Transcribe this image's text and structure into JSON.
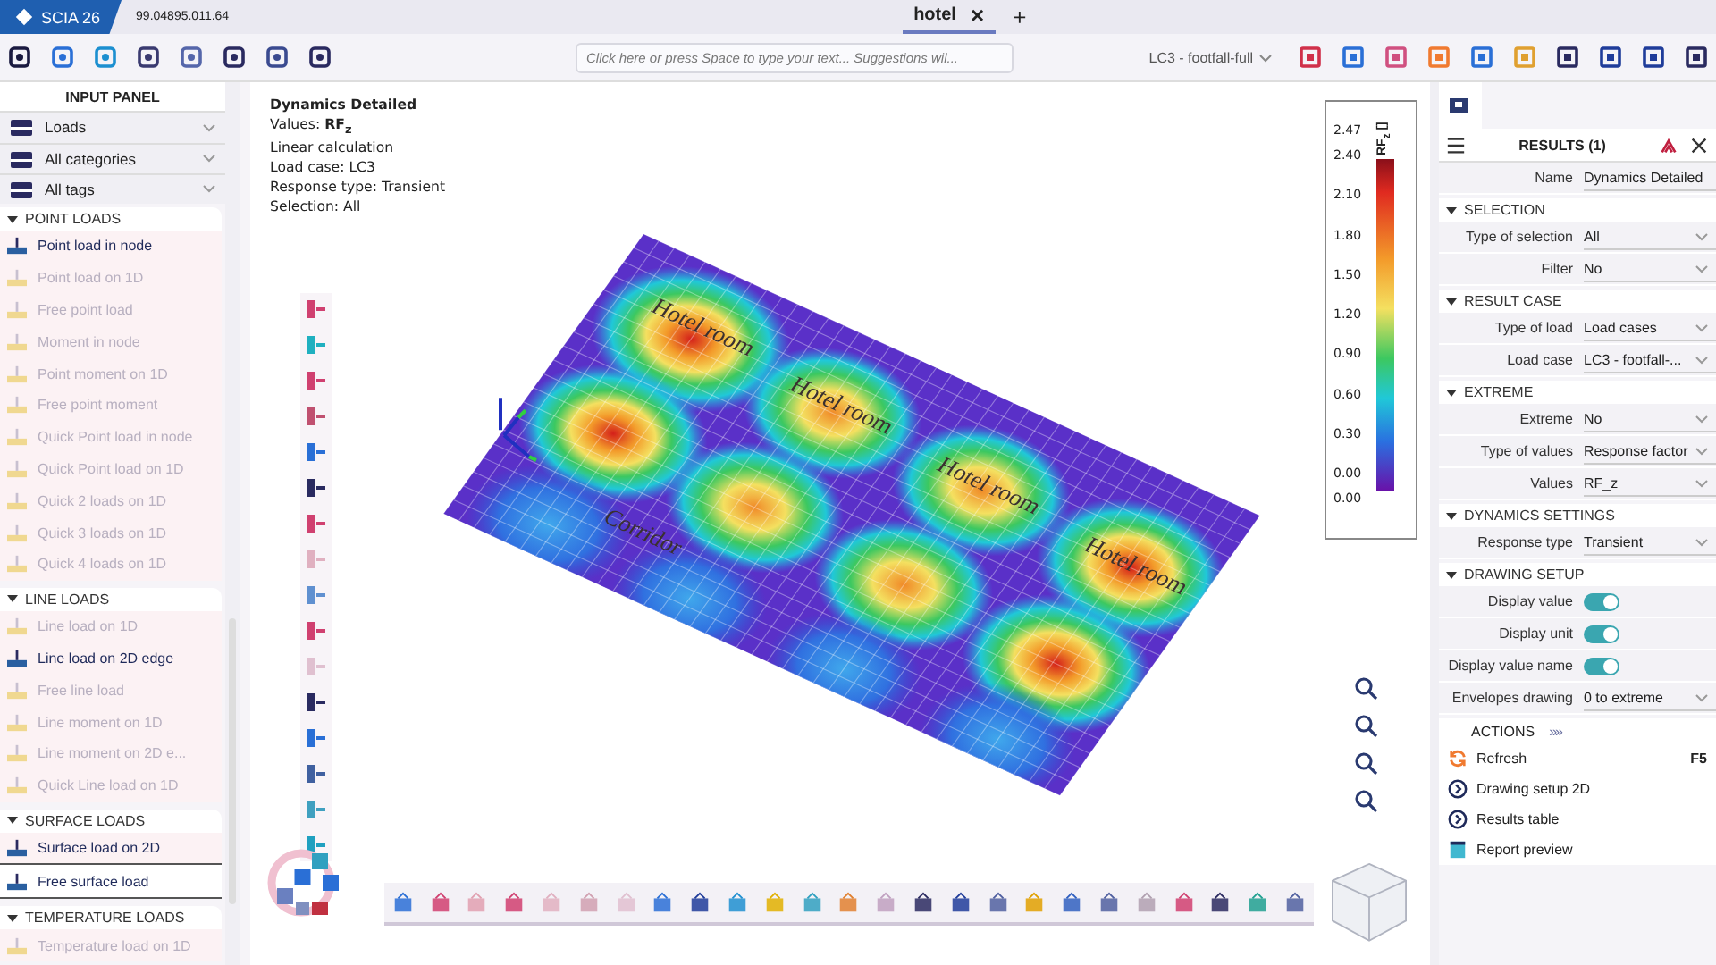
{
  "app": {
    "name": "SCIA 26",
    "version": "99.04895.011.64"
  },
  "tabs": [
    {
      "label": "hotel",
      "selected": true,
      "close": "×"
    }
  ],
  "new_tab": "+",
  "toolbar": {
    "command_placeholder": "Click here or press Space to type your text... Suggestions wil...",
    "load_case": "LC3 - footfall-full"
  },
  "input_panel": {
    "title": "INPUT PANEL",
    "filters": [
      {
        "label": "Loads"
      },
      {
        "label": "All categories"
      },
      {
        "label": "All tags"
      }
    ],
    "groups": [
      {
        "title": "POINT LOADS",
        "expanded": true,
        "items": [
          {
            "label": "Point load in node",
            "enabled": true,
            "selected": false
          },
          {
            "label": "Point load on 1D",
            "enabled": false,
            "selected": false
          },
          {
            "label": "Free point load",
            "enabled": false,
            "selected": false
          },
          {
            "label": "Moment in node",
            "enabled": false,
            "selected": false
          },
          {
            "label": "Point moment on 1D",
            "enabled": false,
            "selected": false
          },
          {
            "label": "Free point moment",
            "enabled": false,
            "selected": false
          },
          {
            "label": "Quick Point load in node",
            "enabled": false,
            "selected": false
          },
          {
            "label": "Quick Point load on 1D",
            "enabled": false,
            "selected": false
          },
          {
            "label": "Quick 2 loads on 1D",
            "enabled": false,
            "selected": false
          },
          {
            "label": "Quick 3 loads on 1D",
            "enabled": false,
            "selected": false
          },
          {
            "label": "Quick 4 loads on 1D",
            "enabled": false,
            "selected": false
          }
        ]
      },
      {
        "title": "LINE LOADS",
        "expanded": true,
        "items": [
          {
            "label": "Line load on 1D",
            "enabled": false,
            "selected": false
          },
          {
            "label": "Line load on 2D edge",
            "enabled": true,
            "selected": false
          },
          {
            "label": "Free line load",
            "enabled": false,
            "selected": false
          },
          {
            "label": "Line moment on 1D",
            "enabled": false,
            "selected": false
          },
          {
            "label": "Line moment on 2D e...",
            "enabled": false,
            "selected": false
          },
          {
            "label": "Quick Line load on 1D",
            "enabled": false,
            "selected": false
          }
        ]
      },
      {
        "title": "SURFACE LOADS",
        "expanded": true,
        "items": [
          {
            "label": "Surface load on 2D",
            "enabled": true,
            "selected": false
          },
          {
            "label": "Free surface load",
            "enabled": true,
            "selected": true
          }
        ]
      },
      {
        "title": "TEMPERATURE LOADS",
        "expanded": true,
        "items": [
          {
            "label": "Temperature load on 1D",
            "enabled": false,
            "selected": false
          }
        ]
      }
    ]
  },
  "view": {
    "info": {
      "title": "Dynamics Detailed",
      "lines": [
        "Values: **RF$_{z}$**",
        "Linear calculation",
        "Load case: LC3",
        "Response type: Transient",
        "Selection: All"
      ]
    },
    "zones": [
      {
        "label": "Hotel room"
      },
      {
        "label": "Hotel room"
      },
      {
        "label": "Hotel room"
      },
      {
        "label": "Hotel room"
      },
      {
        "label": "Corridor"
      }
    ],
    "legend": {
      "title": "RF$_{z}$ []",
      "max": "2.47",
      "ticks": [
        "2.40",
        "2.10",
        "1.80",
        "1.50",
        "1.20",
        "0.90",
        "0.60",
        "0.30",
        "0.00"
      ],
      "min": "0.00"
    }
  },
  "results_panel": {
    "title": "RESULTS (1)",
    "name": {
      "label": "Name",
      "value": "Dynamics Detailed"
    },
    "sections": [
      {
        "title": "SELECTION",
        "expanded": true,
        "rows": [
          {
            "kind": "dropdown",
            "label": "Type of selection",
            "value": "All"
          },
          {
            "kind": "dropdown",
            "label": "Filter",
            "value": "No"
          }
        ]
      },
      {
        "title": "RESULT CASE",
        "expanded": true,
        "rows": [
          {
            "kind": "dropdown",
            "label": "Type of load",
            "value": "Load cases"
          },
          {
            "kind": "dropdown",
            "label": "Load case",
            "value": "LC3 - footfall-..."
          }
        ]
      },
      {
        "title": "EXTREME",
        "expanded": true,
        "rows": [
          {
            "kind": "dropdown",
            "label": "Extreme",
            "value": "No"
          },
          {
            "kind": "dropdown",
            "label": "Type of values",
            "value": "Response factor"
          },
          {
            "kind": "dropdown",
            "label": "Values",
            "value": "RF_z"
          }
        ]
      },
      {
        "title": "DYNAMICS SETTINGS",
        "expanded": true,
        "rows": [
          {
            "kind": "dropdown",
            "label": "Response type",
            "value": "Transient"
          }
        ]
      },
      {
        "title": "DRAWING SETUP",
        "expanded": true,
        "rows": [
          {
            "kind": "toggle",
            "label": "Display value",
            "on": true
          },
          {
            "kind": "toggle",
            "label": "Display unit",
            "on": true
          },
          {
            "kind": "toggle",
            "label": "Display value name",
            "on": true
          },
          {
            "kind": "dropdown",
            "label": "Envelopes drawing",
            "value": "0 to extreme"
          }
        ]
      }
    ],
    "actions_title": "ACTIONS",
    "actions_more": "»»",
    "actions": [
      {
        "kind": "refresh",
        "label": "Refresh",
        "shortcut": "F5"
      },
      {
        "kind": "open",
        "label": "Drawing setup 2D"
      },
      {
        "kind": "open",
        "label": "Results table"
      },
      {
        "kind": "report",
        "label": "Report preview"
      }
    ]
  }
}
